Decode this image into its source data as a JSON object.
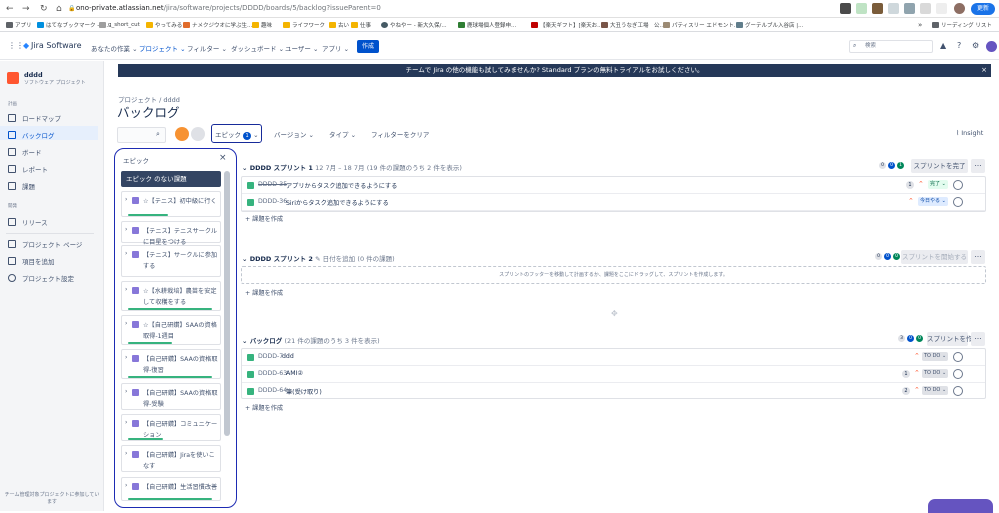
{
  "browser": {
    "url_host": "ono-private.atlassian.net",
    "url_path": "/jira/software/projects/DDDD/boards/5/backlog?issueParent=0",
    "update_label": "更新"
  },
  "bookmarks": [
    "アプリ",
    "はてなブックマーク - 人...",
    "g_short_cut",
    "やってみる",
    "ナメクジウオに学ぶ生...",
    "趣味",
    "ライフワーク",
    "古い",
    "仕事",
    "やねやー - 新大久保/...",
    "鹿球場個人登録申...",
    "【楽天ギフト】[楽天お...",
    "大丑うなぎ工場　公...",
    "パティスリー エドモント...",
    "グーテルブル入谷店 |...",
    "リーディング リスト"
  ],
  "topnav": {
    "product": "Jira Software",
    "items": [
      "あなたの作業",
      "プロジェクト",
      "フィルター",
      "ダッシュボード",
      "ユーザー",
      "アプリ"
    ],
    "create_label": "作成",
    "search_placeholder": "検索"
  },
  "sidebar": {
    "project_name": "dddd",
    "project_type": "ソフトウェア プロジェクト",
    "section_plan": "計画",
    "items": [
      "ロードマップ",
      "バックログ",
      "ボード",
      "レポート",
      "課題"
    ],
    "section_dev": "開発",
    "dev_items": [
      "リリース"
    ],
    "bottom_items": [
      "プロジェクト ページ",
      "項目を追加",
      "プロジェクト設定"
    ],
    "footer": "チーム管理対象プロジェクトに参加しています"
  },
  "banner": {
    "text": "チームで Jira の他の機能も試してみませんか? Standard プランの無料トライアルをお試しください。",
    "close": "×"
  },
  "board": {
    "breadcrumb": "プロジェクト  /  dddd",
    "title": "バックログ",
    "filters": {
      "epic_label": "エピック",
      "epic_count": "1",
      "version_label": "バージョン",
      "type_label": "タイプ",
      "clear_label": "フィルターをクリア",
      "insight_label": "Insight"
    }
  },
  "epic_panel": {
    "title": "エピック",
    "close": "×",
    "no_epic": "エピック のない課題",
    "epics": [
      {
        "name": "☆【テニス】初中級に行く",
        "progress": 0.45
      },
      {
        "name": "【テニス】テニスサークルに目星をつける",
        "progress": 0
      },
      {
        "name": "【テニス】サークルに参加する",
        "progress": 0
      },
      {
        "name": "☆【水耕栽培】農苗を安定して収穫をする",
        "progress": 0.95
      },
      {
        "name": "☆【自己研鑽】SAAの資格取得-1週目",
        "progress": 0.5
      },
      {
        "name": "【自己研鑽】SAAの資格取得-復習",
        "progress": 0.95
      },
      {
        "name": "【自己研鑽】SAAの資格取得-受験",
        "progress": 0
      },
      {
        "name": "【自己研鑽】コミュニケーション",
        "progress": 0.4
      },
      {
        "name": "【自己研鑽】Jiraを使いこなす",
        "progress": 0
      },
      {
        "name": "【自己研鑽】生活習慣改善",
        "progress": 0.95
      }
    ]
  },
  "sprint1": {
    "name": "DDDD スプリント 1",
    "dates": "12 7月 – 18 7月",
    "subtitle": "(19 件の課題のうち 2 件を表示)",
    "counts": [
      "0",
      "0",
      "1"
    ],
    "action": "スプリントを完了",
    "issues": [
      {
        "key": "DDDD-35",
        "summary": "アプリからタスク追加できるようにする",
        "points": "1",
        "status": "完了",
        "done": true
      },
      {
        "key": "DDDD-36",
        "summary": "Siriからタスク追加できるようにする",
        "points": "",
        "status": "今日やる",
        "done": false
      }
    ],
    "create": "+ 課題を作成"
  },
  "sprint2": {
    "name": "DDDD スプリント 2",
    "dates": "✎ 日付を追加",
    "subtitle": "(0 件の課題)",
    "counts": [
      "0",
      "0",
      "0"
    ],
    "action": "スプリントを開始する",
    "empty": "スプリントのフッターを移動して計画するか、課題をここにドラッグして、スプリントを作成します。",
    "create": "+ 課題を作成"
  },
  "backlog": {
    "name": "バックログ",
    "subtitle": "(21 件の課題のうち 3 件を表示)",
    "counts": [
      "3",
      "0",
      "0"
    ],
    "action": "スプリントを作成",
    "issues": [
      {
        "key": "DDDD-7",
        "summary": "ddd",
        "points": "",
        "status": "TO DO"
      },
      {
        "key": "DDDD-63",
        "summary": "AMI②",
        "points": "1",
        "status": "TO DO"
      },
      {
        "key": "DDDD-64",
        "summary": "筆(受け取り)",
        "points": "2",
        "status": "TO DO"
      }
    ],
    "create": "+ 課題を作成"
  },
  "colors": {
    "brand": "#0052cc",
    "banner": "#253858",
    "story": "#36b37e",
    "epic": "#8777d9",
    "done_badge": "#e3fcef",
    "doing_badge": "#deebff"
  }
}
